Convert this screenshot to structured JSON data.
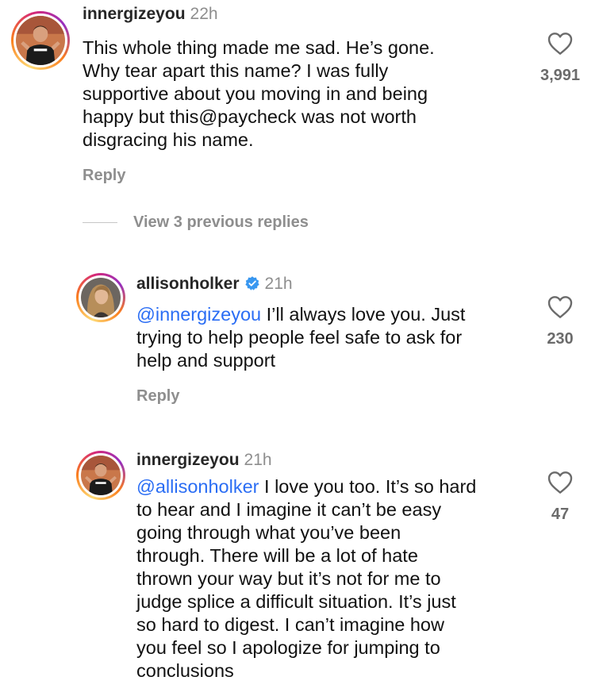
{
  "comments": [
    {
      "username": "innergizeyou",
      "time": "22h",
      "mention": "",
      "lines": [
        "This whole thing made me sad. He’s gone.",
        "Why tear apart this name? I was fully",
        "supportive about you moving in and being",
        "happy but this@paycheck was not worth",
        "disgracing his name."
      ],
      "likes": "3,991",
      "reply_label": "Reply"
    },
    {
      "username": "allisonholker",
      "verified": true,
      "time": "21h",
      "mention": "@innergizeyou",
      "lines": [
        " I’ll always love you.  Just",
        "trying to help people feel safe to ask for",
        "help and support"
      ],
      "likes": "230",
      "reply_label": "Reply"
    },
    {
      "username": "innergizeyou",
      "time": "21h",
      "mention": "@allisonholker",
      "lines": [
        " I love you too. It’s so hard",
        "to hear and I imagine it can’t be easy",
        "going through what you’ve been",
        "through. There will be a lot of hate",
        "thrown your way but it’s not for me to",
        "judge splice a difficult situation. It’s just",
        "so hard to digest. I can’t imagine how",
        "you feel so I apologize for jumping to",
        "conclusions"
      ],
      "likes": "47"
    }
  ],
  "view_previous_replies": "View 3 previous replies",
  "colors": {
    "mention": "#2a6df4",
    "muted": "#8e8e8e",
    "verified": "#3897f0"
  },
  "icons": {
    "like": "heart-outline-icon",
    "verified": "verified-badge-icon"
  }
}
